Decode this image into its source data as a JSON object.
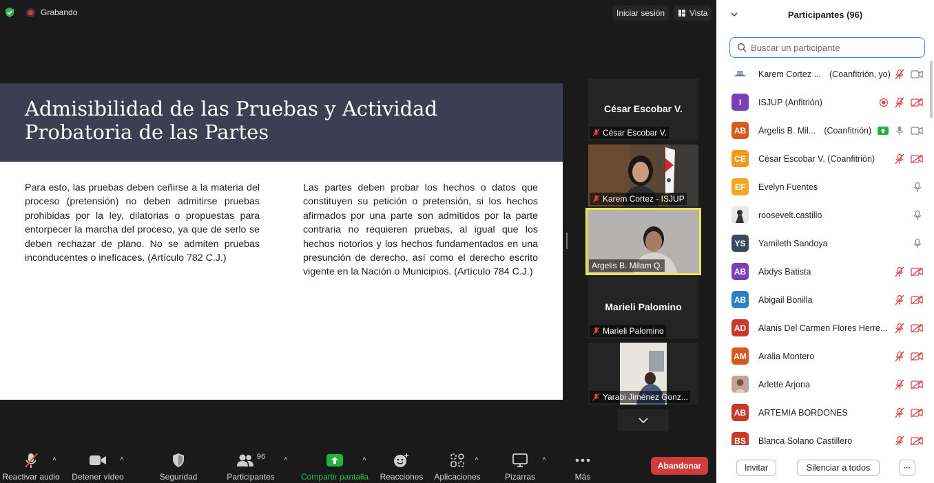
{
  "topbar": {
    "recording_label": "Grabando",
    "signin_label": "Iniciar sesión",
    "view_label": "Vista"
  },
  "slide": {
    "title": "Admisibilidad de las Pruebas y Actividad Probatoria de las Partes",
    "col1": "Para esto, las pruebas deben ceñirse a la materia del proceso (pretensión) no deben admitirse pruebas prohibidas por la ley, dilatorias o propuestas para entorpecer la marcha del proceso, ya que de serlo se deben rechazar de plano. No se admiten pruebas inconducentes o ineficaces. (Artículo 782 C.J.)",
    "col2": "Las partes deben probar los hechos o datos que constituyen su petición o pretensión, si los hechos afirmados por una parte son admitidos por la parte contraria no requieren pruebas, al igual que los hechos notorios y los hechos fundamentados en una presunción de derecho, así como el derecho escrito vigente en la Nación o Municipios. (Artículo 784 C.J.)"
  },
  "gallery": [
    {
      "center_name": "César Escobar V.",
      "label": "César Escobar V."
    },
    {
      "label": "Karem Cortez - ISJUP"
    },
    {
      "label": "Argelis B. Milam Q."
    },
    {
      "center_name": "Marieli Palomino",
      "label": "Marieli Palomino"
    },
    {
      "label": "Yarabi Jiménez Gonz..."
    }
  ],
  "toolbar": {
    "audio": "Reactivar audio",
    "video": "Detener vídeo",
    "security": "Seguridad",
    "participants": "Participantes",
    "participants_count": "96",
    "share": "Compartir pantalla",
    "reactions": "Reacciones",
    "apps": "Aplicaciones",
    "whiteboards": "Pizarras",
    "more": "Más",
    "leave": "Abandonar"
  },
  "panel": {
    "title": "Participantes (96)",
    "search_placeholder": "Buscar un participante",
    "participants": [
      {
        "name": "Karem Cortez ...",
        "role": "(Coanfitrión, yo)",
        "initials": "",
        "color": "#ffffff"
      },
      {
        "name": "ISJUP (Anfitrión)",
        "role": "",
        "initials": "I",
        "color": "#7b3fb8"
      },
      {
        "name": "Argelis B. Mil...",
        "role": "(Coanfitrión)",
        "initials": "AB",
        "color": "#d65a1c"
      },
      {
        "name": "César Escobar V. (Coanfitrión)",
        "role": "",
        "initials": "CE",
        "color": "#f09a1c"
      },
      {
        "name": "Evelyn Fuentes",
        "role": "",
        "initials": "EF",
        "color": "#f5a623"
      },
      {
        "name": "roosevelt.castillo",
        "role": "",
        "initials": "",
        "color": "#dddddd"
      },
      {
        "name": "Yamileth Sandoya",
        "role": "",
        "initials": "YS",
        "color": "#3b4a5c"
      },
      {
        "name": "Abdys Batista",
        "role": "",
        "initials": "AB",
        "color": "#7b3fb8"
      },
      {
        "name": "Abigail Bonilla",
        "role": "",
        "initials": "AB",
        "color": "#2f80c2"
      },
      {
        "name": "Alanis Del Carmen Flores Herre...",
        "role": "",
        "initials": "AD",
        "color": "#c93a2b"
      },
      {
        "name": "Aralia Montero",
        "role": "",
        "initials": "AM",
        "color": "#d65a1c"
      },
      {
        "name": "Arlette Arjona",
        "role": "",
        "initials": "",
        "color": "#b98c84"
      },
      {
        "name": "ARTEMIA BORDONES",
        "role": "",
        "initials": "AB",
        "color": "#c93a2b"
      },
      {
        "name": "Blanca Solano Castillero",
        "role": "",
        "initials": "BS",
        "color": "#c93a2b"
      }
    ],
    "invite": "Invitar",
    "mute_all": "Silenciar a todos",
    "more": "···"
  }
}
